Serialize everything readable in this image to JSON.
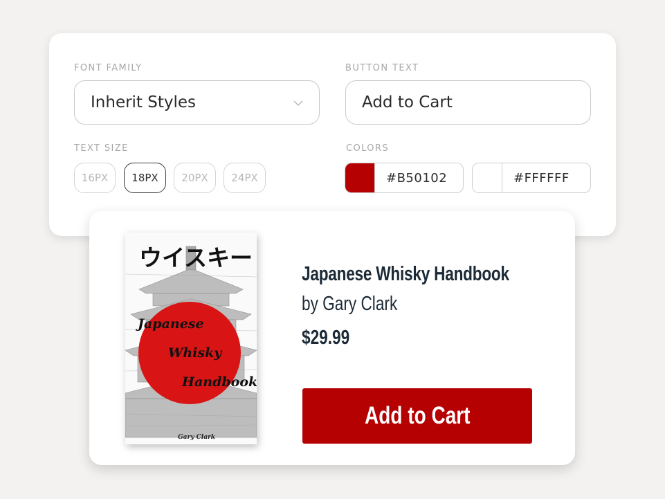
{
  "settings": {
    "font_family": {
      "label": "FONT FAMILY",
      "value": "Inherit Styles"
    },
    "button_text": {
      "label": "BUTTON TEXT",
      "value": "Add to Cart"
    },
    "text_size": {
      "label": "TEXT SIZE",
      "options": [
        "16PX",
        "18PX",
        "20PX",
        "24PX"
      ],
      "selected": "18PX"
    },
    "colors": {
      "label": "COLORS",
      "primary": "#B50102",
      "secondary": "#FFFFFF"
    }
  },
  "product": {
    "cover": {
      "japanese_title": "ウイスキー",
      "title_lines": [
        "Japanese",
        "Whisky",
        "Handbook"
      ],
      "author": "Gary Clark"
    },
    "title": "Japanese Whisky Handbook",
    "author": "by Gary Clark",
    "price": "$29.99",
    "button_label": "Add to Cart"
  }
}
